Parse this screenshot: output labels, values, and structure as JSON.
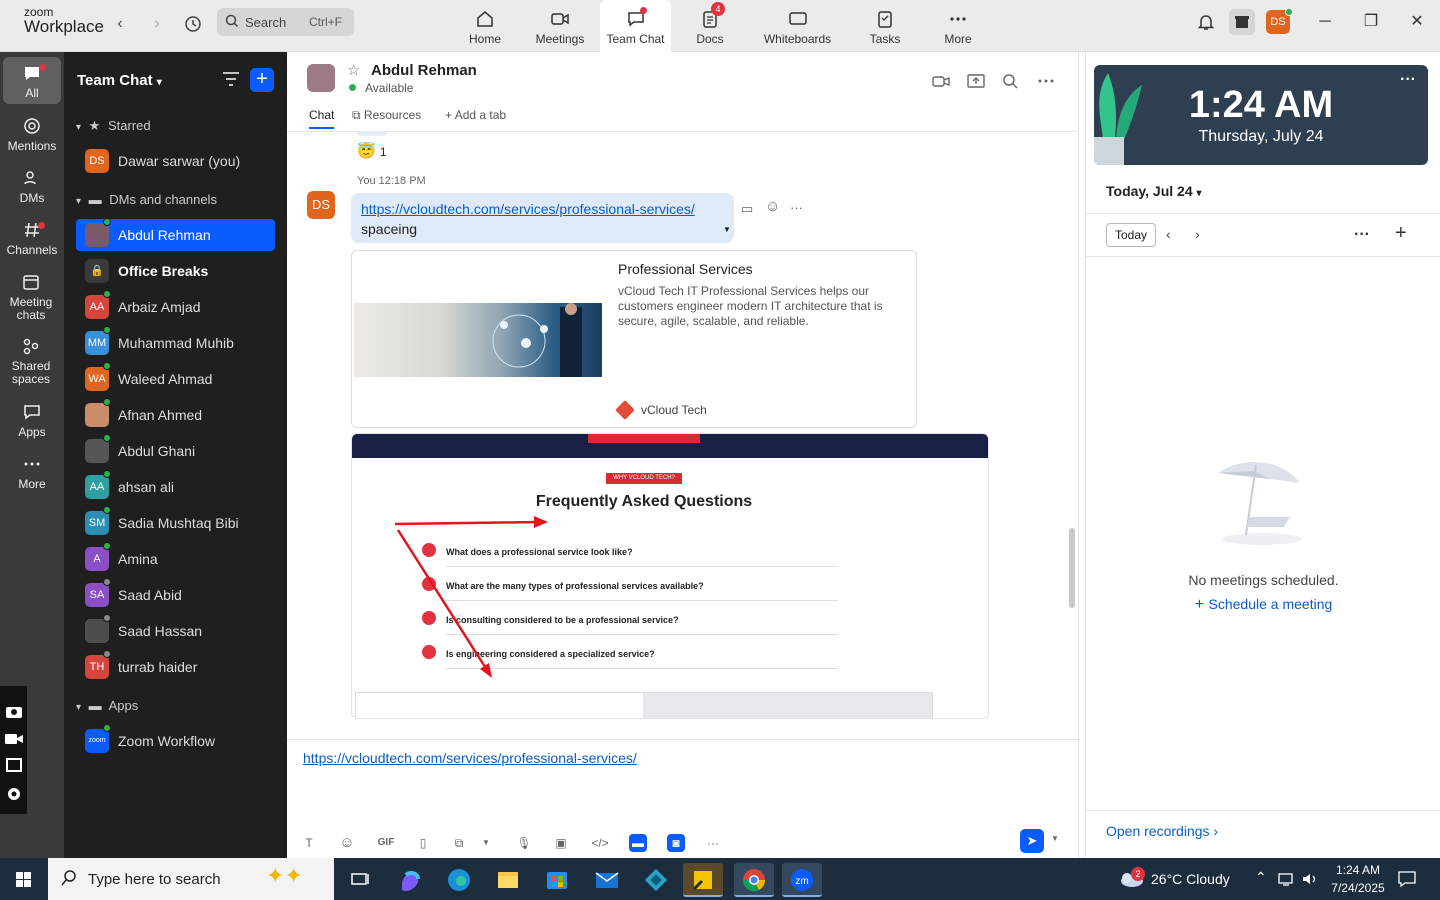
{
  "app": {
    "brand_top": "zoom",
    "brand_bottom": "Workplace"
  },
  "search": {
    "label": "Search",
    "shortcut": "Ctrl+F"
  },
  "topnav": [
    {
      "label": "Home"
    },
    {
      "label": "Meetings"
    },
    {
      "label": "Team Chat"
    },
    {
      "label": "Docs",
      "badge": "4"
    },
    {
      "label": "Whiteboards"
    },
    {
      "label": "Tasks"
    },
    {
      "label": "More"
    }
  ],
  "user_avatar": "DS",
  "rail": [
    {
      "label": "All"
    },
    {
      "label": "Mentions"
    },
    {
      "label": "DMs"
    },
    {
      "label": "Channels"
    },
    {
      "label": "Meeting chats"
    },
    {
      "label": "Shared spaces"
    },
    {
      "label": "Apps"
    },
    {
      "label": "More"
    }
  ],
  "sidebar": {
    "title": "Team Chat",
    "starred_label": "Starred",
    "dms_label": "DMs and channels",
    "apps_label": "Apps",
    "starred": [
      {
        "initials": "DS",
        "name": "Dawar sarwar (you)",
        "color": "#e0651e"
      }
    ],
    "contacts": [
      {
        "initials": "",
        "name": "Abdul Rehman",
        "color": "#7a5a6a",
        "presence": "#2bb14a"
      },
      {
        "initials": "",
        "name": "Office Breaks",
        "color": "#3a3a3a",
        "presence": ""
      },
      {
        "initials": "AA",
        "name": "Arbaiz Amjad",
        "color": "#d6453d",
        "presence": "#2bb14a"
      },
      {
        "initials": "MM",
        "name": "Muhammad Muhib",
        "color": "#3a8fd6",
        "presence": "#2bb14a"
      },
      {
        "initials": "WA",
        "name": "Waleed Ahmad",
        "color": "#e0651e",
        "presence": "#2bb14a"
      },
      {
        "initials": "",
        "name": "Afnan Ahmed",
        "color": "#c98d6a",
        "presence": "#2bb14a"
      },
      {
        "initials": "",
        "name": "Abdul Ghani",
        "color": "#555555",
        "presence": "#2bb14a"
      },
      {
        "initials": "AA",
        "name": "ahsan ali",
        "color": "#2f9fa0",
        "presence": "#2bb14a"
      },
      {
        "initials": "SM",
        "name": "Sadia Mushtaq Bibi",
        "color": "#2a8fb0",
        "presence": "#2bb14a"
      },
      {
        "initials": "A",
        "name": "Amina",
        "color": "#8a4fc4",
        "presence": "#2bb14a"
      },
      {
        "initials": "SA",
        "name": "Saad Abid",
        "color": "#8a4fc4",
        "presence": "#888888"
      },
      {
        "initials": "",
        "name": "Saad Hassan",
        "color": "#4d4d4d",
        "presence": "#888888"
      },
      {
        "initials": "TH",
        "name": "turrab haider",
        "color": "#d6453d",
        "presence": "#888888"
      }
    ],
    "apps": [
      {
        "initials": "zoom",
        "name": "Zoom Workflow",
        "color": "#0b5cff",
        "presence": "#2bb14a"
      }
    ]
  },
  "chat": {
    "contact_name": "Abdul Rehman",
    "status": "Available",
    "tabs": [
      "Chat",
      "Resources",
      "Add a tab"
    ],
    "reaction_count": "1",
    "msg_meta": "You 12:18 PM",
    "sender_initials": "DS",
    "link": "https://vcloudtech.com/services/professional-services/",
    "msg_text": "spaceing",
    "preview": {
      "title": "Professional Services",
      "desc": "vCloud Tech IT Professional Services helps our customers engineer modern IT architecture that is secure, agile, scalable, and reliable.",
      "site": "vCloud Tech"
    },
    "screenshot": {
      "tag": "WHY VCLOUD TECH?",
      "heading": "Frequently Asked Questions",
      "questions": [
        "What does a professional service look like?",
        "What are the many types of professional services available?",
        "Is consulting considered to be a professional service?",
        "Is engineering considered a specialized service?"
      ]
    },
    "compose_text": "https://vcloudtech.com/services/professional-services/"
  },
  "right": {
    "time": "1:24 AM",
    "date": "Thursday, July 24",
    "day_label": "Today, Jul 24",
    "today_btn": "Today",
    "empty_text": "No meetings scheduled.",
    "schedule": "Schedule a meeting",
    "recordings": "Open recordings"
  },
  "taskbar": {
    "search_placeholder": "Type here to search",
    "weather": "26°C  Cloudy",
    "weather_badge": "2",
    "time": "1:24 AM",
    "date": "7/24/2025"
  }
}
